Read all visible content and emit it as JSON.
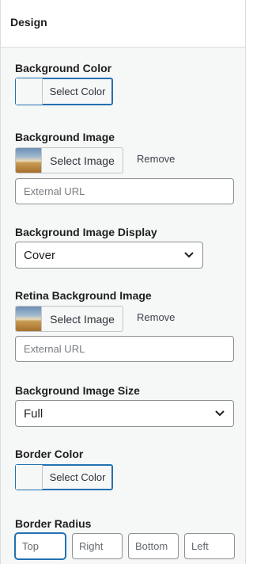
{
  "header": {
    "title": "Design"
  },
  "background_color": {
    "label": "Background Color",
    "button": "Select Color"
  },
  "background_image": {
    "label": "Background Image",
    "button": "Select Image",
    "remove": "Remove",
    "url_placeholder": "External URL"
  },
  "background_image_display": {
    "label": "Background Image Display",
    "value": "Cover"
  },
  "retina_background_image": {
    "label": "Retina Background Image",
    "button": "Select Image",
    "remove": "Remove",
    "url_placeholder": "External URL"
  },
  "background_image_size": {
    "label": "Background Image Size",
    "value": "Full"
  },
  "border_color": {
    "label": "Border Color",
    "button": "Select Color"
  },
  "border_radius": {
    "label": "Border Radius",
    "placeholders": {
      "top": "Top",
      "right": "Right",
      "bottom": "Bottom",
      "left": "Left"
    }
  }
}
